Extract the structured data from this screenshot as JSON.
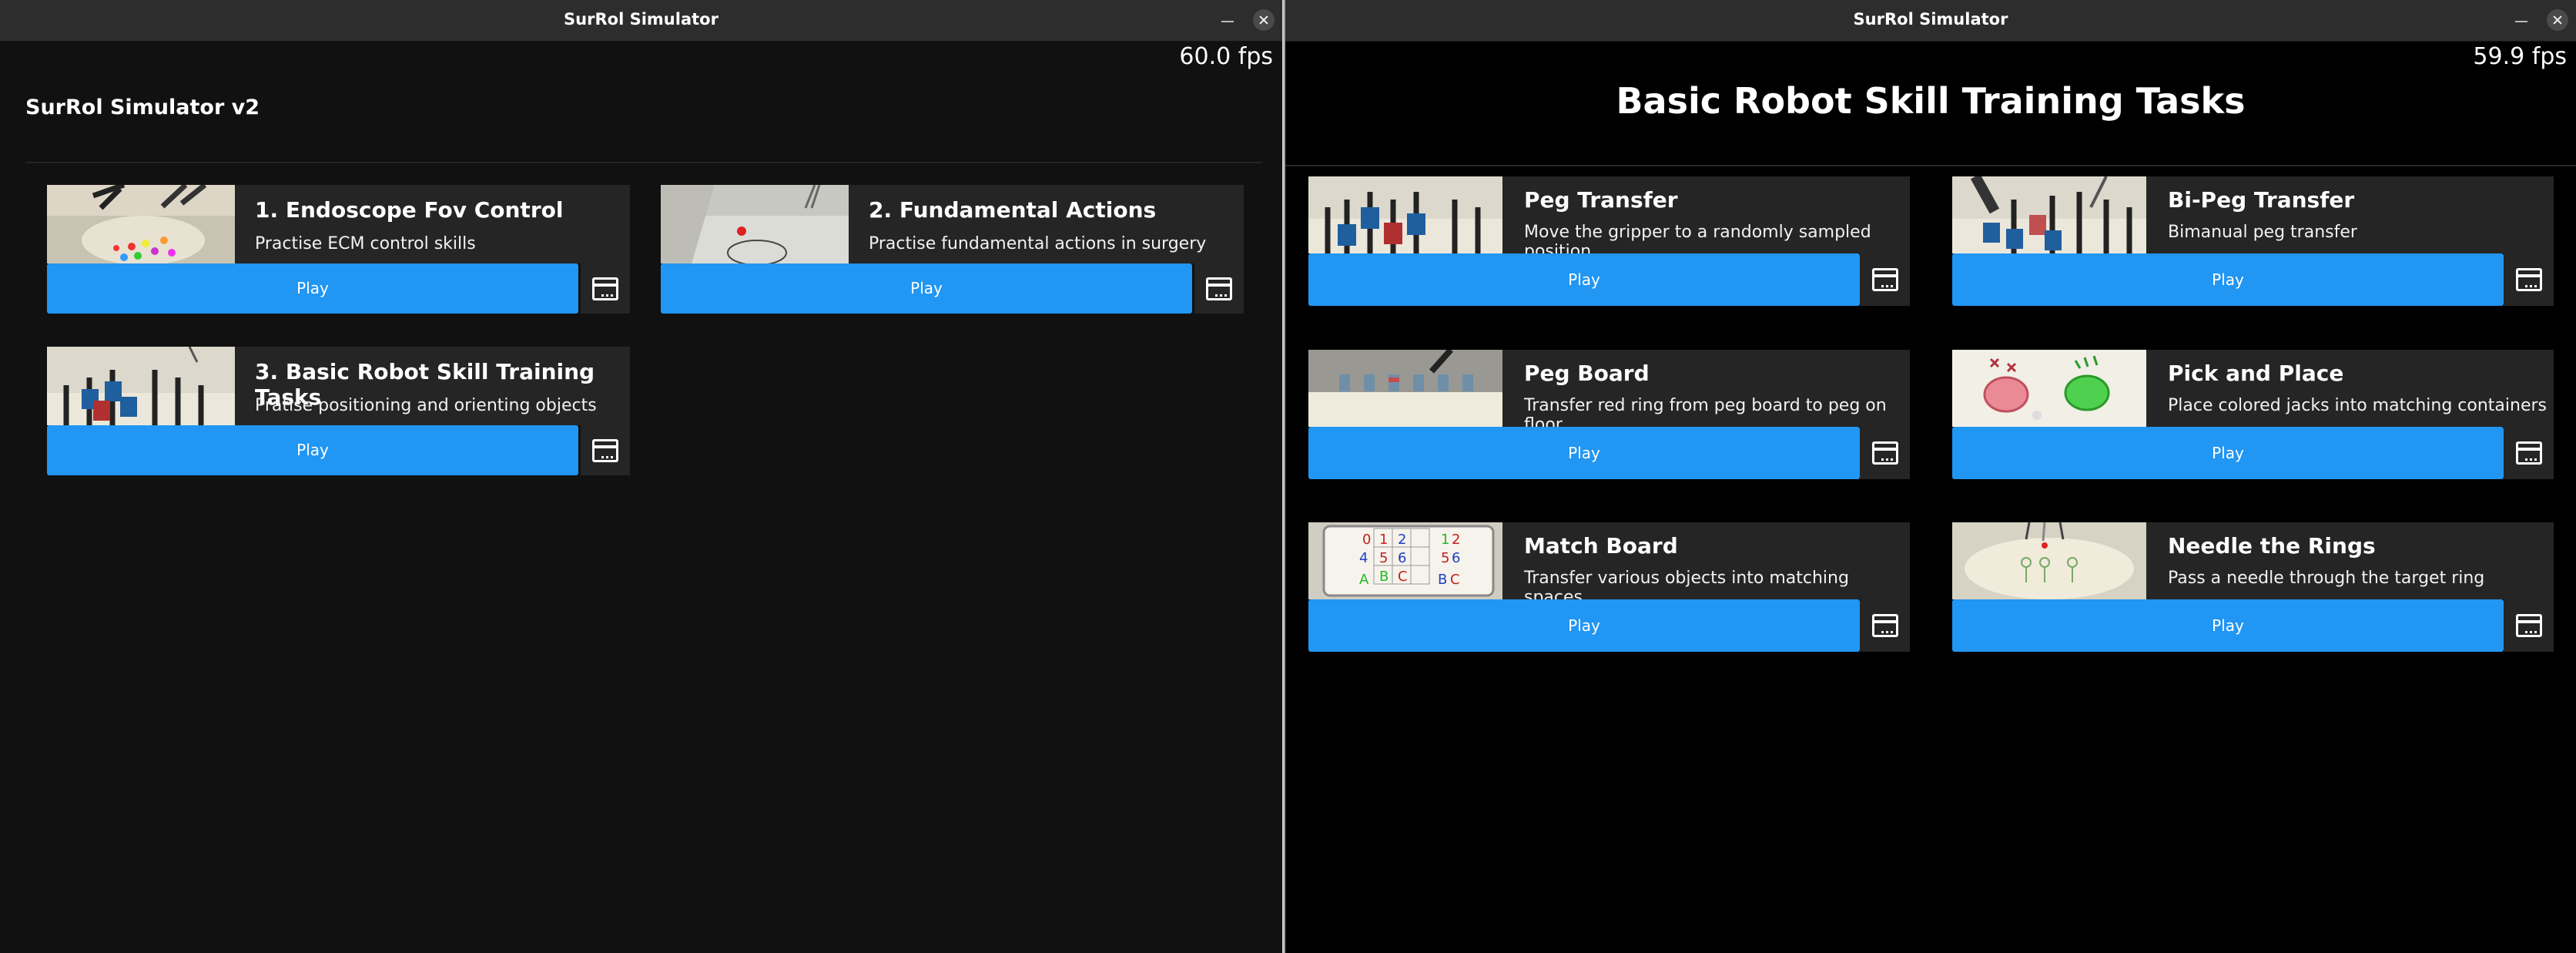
{
  "left_window": {
    "title": "SurRol Simulator",
    "fps": "60.0 fps",
    "app_title": "SurRol Simulator v2",
    "tasks": [
      {
        "title": "1. Endoscope Fov Control",
        "desc": "Practise ECM control skills",
        "play": "Play",
        "thumb_icon": "endoscope-scene-thumbnail"
      },
      {
        "title": "2. Fundamental Actions",
        "desc": "Practise fundamental actions in surgery",
        "play": "Play",
        "thumb_icon": "fundamental-actions-thumbnail"
      },
      {
        "title": "3. Basic Robot Skill Training Tasks",
        "desc": "Pratise positioning and orienting objects",
        "play": "Play",
        "thumb_icon": "peg-board-thumbnail"
      }
    ]
  },
  "right_window": {
    "title": "SurRol Simulator",
    "fps": "59.9 fps",
    "page_title": "Basic Robot Skill Training Tasks",
    "tasks": [
      {
        "title": "Peg Transfer",
        "desc": "Move the gripper to a randomly sampled position",
        "play": "Play"
      },
      {
        "title": "Bi-Peg Transfer",
        "desc": "Bimanual peg transfer",
        "play": "Play"
      },
      {
        "title": "Peg Board",
        "desc": "Transfer red ring from peg board to peg on floor",
        "play": "Play"
      },
      {
        "title": "Pick and Place",
        "desc": "Place colored jacks into matching containers",
        "play": "Play"
      },
      {
        "title": "Match Board",
        "desc": "Transfer various objects into matching spaces",
        "play": "Play"
      },
      {
        "title": "Needle the Rings",
        "desc": "Pass a needle through the target ring",
        "play": "Play"
      }
    ]
  },
  "match_board_symbols": [
    "0",
    "1",
    "2",
    "1",
    "2",
    "4",
    "5",
    "6",
    "5",
    "6",
    "A",
    "B",
    "C",
    "B",
    "C"
  ],
  "colors": {
    "accent": "#2196f3",
    "card": "#252525",
    "bg_left": "#111111",
    "bg_right": "#000000"
  }
}
